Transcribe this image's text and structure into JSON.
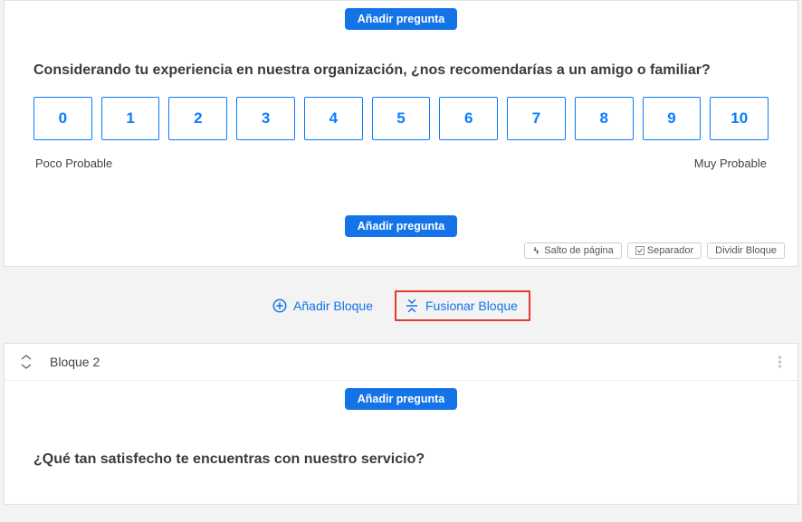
{
  "block1": {
    "add_question_label": "Añadir pregunta",
    "question_text": "Considerando tu experiencia en nuestra organización, ¿nos recomendarías a un amigo o familiar?",
    "nps_values": [
      "0",
      "1",
      "2",
      "3",
      "4",
      "5",
      "6",
      "7",
      "8",
      "9",
      "10"
    ],
    "label_low": "Poco Probable",
    "label_high": "Muy Probable",
    "add_question_bottom": "Añadir pregunta",
    "tools": {
      "page_break": "Salto de página",
      "separator": "Separador",
      "split_block": "Dividir Bloque"
    }
  },
  "between": {
    "add_block": "Añadir Bloque",
    "merge_block": "Fusionar Bloque"
  },
  "block2": {
    "title": "Bloque 2",
    "add_question_label": "Añadir pregunta",
    "question_text": "¿Qué tan satisfecho te encuentras con nuestro servicio?"
  }
}
